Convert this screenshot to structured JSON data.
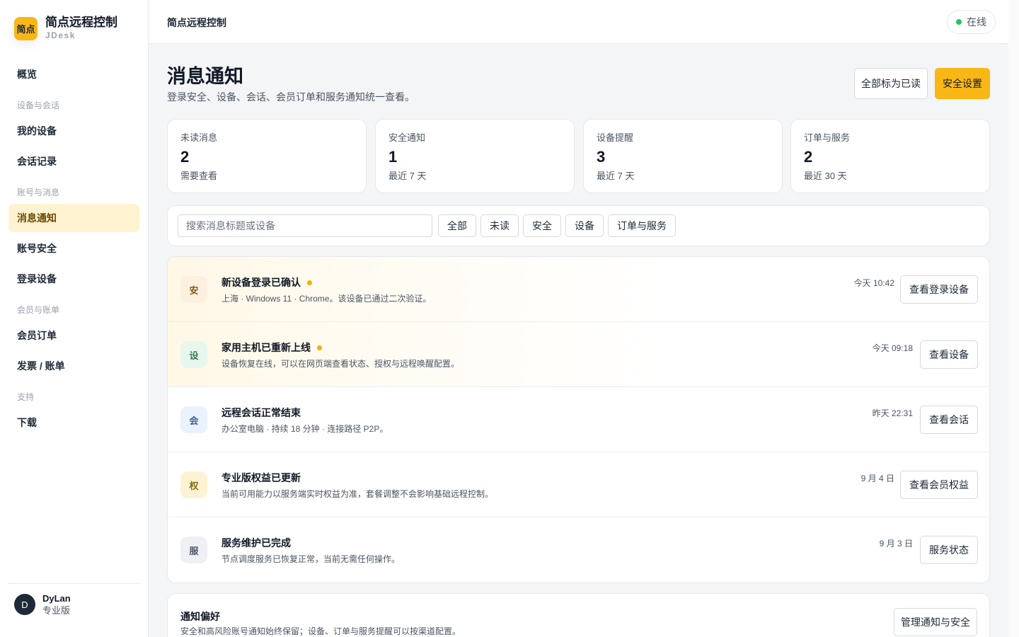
{
  "brand": {
    "logo": "简点",
    "name": "简点远程控制",
    "sub": "JDesk"
  },
  "sidebar": {
    "overview": "概览",
    "section_devices": "设备与会话",
    "my_devices": "我的设备",
    "sessions": "会话记录",
    "section_account": "账号与消息",
    "notifications": "消息通知",
    "security": "账号安全",
    "login_devices": "登录设备",
    "section_billing": "会员与账单",
    "orders": "会员订单",
    "invoices": "发票 / 账单",
    "section_support": "支持",
    "download": "下载"
  },
  "user": {
    "initial": "D",
    "name": "DyLan",
    "plan": "专业版"
  },
  "topbar": {
    "title": "简点远程控制",
    "status": "在线",
    "status_color": "#22c55e"
  },
  "page": {
    "title": "消息通知",
    "desc": "登录安全、设备、会话、会员订单和服务通知统一查看。",
    "mark_all_read": "全部标为已读",
    "security_settings": "安全设置"
  },
  "stats": [
    {
      "label": "未读消息",
      "value": "2",
      "note": "需要查看"
    },
    {
      "label": "安全通知",
      "value": "1",
      "note": "最近 7 天"
    },
    {
      "label": "设备提醒",
      "value": "3",
      "note": "最近 7 天"
    },
    {
      "label": "订单与服务",
      "value": "2",
      "note": "最近 30 天"
    }
  ],
  "filters": {
    "search_placeholder": "搜索消息标题或设备",
    "chips": [
      "全部",
      "未读",
      "安全",
      "设备",
      "订单与服务"
    ]
  },
  "notifications": [
    {
      "icon": "安",
      "title": "新设备登录已确认",
      "unread": true,
      "desc": "上海 · Windows 11 · Chrome。该设备已通过二次验证。",
      "time": "今天 10:42",
      "action": "查看登录设备",
      "icon_bg": "#fdf0e1",
      "icon_color": "#8a5a1a"
    },
    {
      "icon": "设",
      "title": "家用主机已重新上线",
      "unread": true,
      "desc": "设备恢复在线，可以在网页端查看状态、授权与远程唤醒配置。",
      "time": "今天 09:18",
      "action": "查看设备",
      "icon_bg": "#e8f7ee",
      "icon_color": "#3a7a52"
    },
    {
      "icon": "会",
      "title": "远程会话正常结束",
      "unread": false,
      "desc": "办公室电脑 · 持续 18 分钟 · 连接路径 P2P。",
      "time": "昨天 22:31",
      "action": "查看会话",
      "icon_bg": "#eaf2fd",
      "icon_color": "#3b5f8f"
    },
    {
      "icon": "权",
      "title": "专业版权益已更新",
      "unread": false,
      "desc": "当前可用能力以服务端实时权益为准，套餐调整不会影响基础远程控制。",
      "time": "9 月 4 日",
      "action": "查看会员权益",
      "icon_bg": "#fdf3d4",
      "icon_color": "#8a6a10"
    },
    {
      "icon": "服",
      "title": "服务维护已完成",
      "unread": false,
      "desc": "节点调度服务已恢复正常，当前无需任何操作。",
      "time": "9 月 3 日",
      "action": "服务状态",
      "icon_bg": "#eef0f4",
      "icon_color": "#4b5563"
    }
  ],
  "preferences": {
    "title": "通知偏好",
    "desc": "安全和高风险账号通知始终保留；设备、订单与服务提醒可以按渠道配置。",
    "action": "管理通知与安全"
  }
}
